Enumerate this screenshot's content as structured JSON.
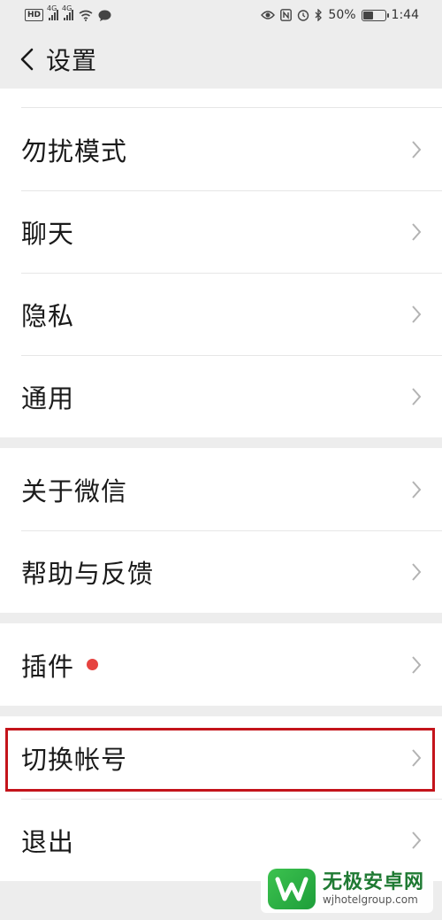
{
  "status_bar": {
    "left_badge": "HD",
    "signal1_tag": "4G",
    "signal2_tag": "4G",
    "battery_percent": "50%",
    "battery_level": 0.5,
    "time": "1:44"
  },
  "header": {
    "title": "设置"
  },
  "groups": [
    {
      "items": [
        {
          "label": "勿扰模式"
        },
        {
          "label": "聊天"
        },
        {
          "label": "隐私"
        },
        {
          "label": "通用"
        }
      ]
    },
    {
      "items": [
        {
          "label": "关于微信"
        },
        {
          "label": "帮助与反馈"
        }
      ]
    },
    {
      "items": [
        {
          "label": "插件",
          "has_dot": true
        }
      ]
    },
    {
      "items": [
        {
          "label": "切换帐号"
        },
        {
          "label": "退出"
        }
      ]
    }
  ],
  "colors": {
    "highlight": "#c4141b",
    "red_dot": "#e64340",
    "background": "#ededed"
  },
  "watermark": {
    "title": "无极安卓网",
    "url": "wjhotelgroup.com"
  }
}
